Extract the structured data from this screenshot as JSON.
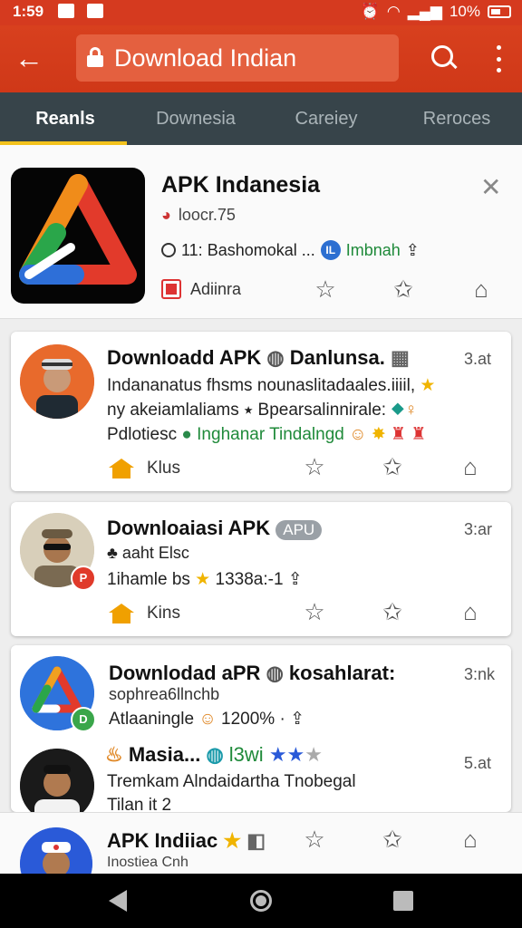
{
  "status": {
    "time": "1:59",
    "battery": "10%"
  },
  "appbar": {
    "url_text": "Download Indian"
  },
  "tabs": [
    {
      "label": "Reanls",
      "active": true
    },
    {
      "label": "Downesia",
      "active": false
    },
    {
      "label": "Careiey",
      "active": false
    },
    {
      "label": "Reroces",
      "active": false
    }
  ],
  "featured": {
    "title": "APK Indanesia",
    "developer": "loocr.75",
    "detail_a": "11: Bashomokal ...",
    "detail_b": "Imbnah",
    "category": "Adiinra"
  },
  "cards": [
    {
      "title": "Downloadd APK",
      "title_extra": "Danlunsa.",
      "time": "3.at",
      "line1": "Indananatus fhsms nounaslitadaales.iiiil,",
      "line2": "ny akeiamlaliams ⭑ Bpearsalinnirale:",
      "line3a": "Pdlotiesc",
      "line3b": "Inghanar Tindalngd",
      "category": "Klus"
    },
    {
      "title": "Downloaiasi APK",
      "pill": "APU",
      "time": "3:ar",
      "line1": "♣ aaht Elsc",
      "line2a": "1ihamle bs",
      "line2b": "1338a:-1",
      "category": "Kins"
    },
    {
      "title": "Downlodad aPR",
      "title_extra": "kosahlarat:",
      "time": "3:nk",
      "line1": "sophrea6llnchb",
      "line2a": "Atlaaningle",
      "line2b": "1200% ·"
    },
    {
      "title": "Masia...",
      "title_extra": "l3wi",
      "time": "5.at",
      "line1": "Tremkam Alndaidartha Tnobegal",
      "line2": "Tilan it 2"
    }
  ],
  "bottom": {
    "title": "APK Indiiac",
    "subtitle": "Inostiea Cnh"
  },
  "colors": {
    "appbar": "#d53a1f",
    "tabbar": "#37444a",
    "tab_indicator": "#f3c21c"
  }
}
